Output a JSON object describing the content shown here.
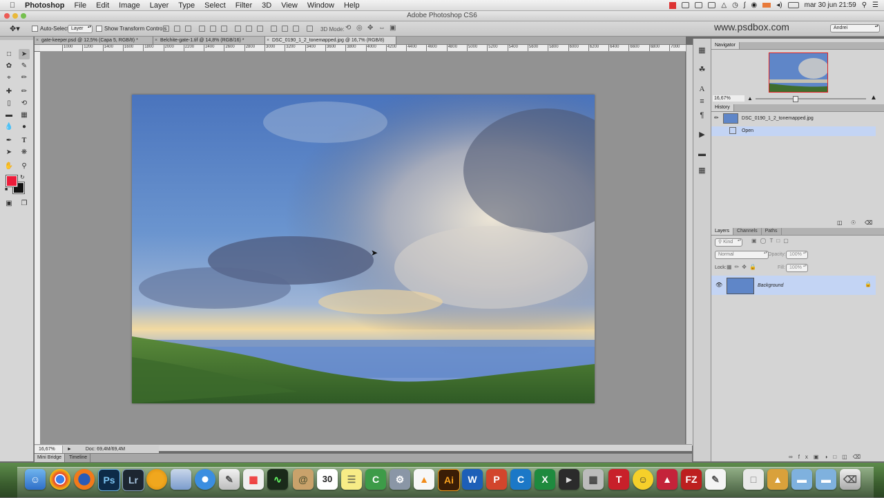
{
  "menubar": {
    "app_name": "Photoshop",
    "items": [
      "File",
      "Edit",
      "Image",
      "Layer",
      "Type",
      "Select",
      "Filter",
      "3D",
      "View",
      "Window",
      "Help"
    ],
    "clock": "mar 30 jun  21:59"
  },
  "window": {
    "title": "Adobe Photoshop CS6"
  },
  "options_bar": {
    "auto_select_label": "Auto-Select:",
    "auto_select_target": "Layer",
    "show_transform_label": "Show Transform Controls",
    "mode_3d_label": "3D Mode:",
    "workspace": "Andrei"
  },
  "watermark_site": "www.psdbox.com",
  "tabs": [
    {
      "label": "gate-keeper.psd @ 12,5% (Capa 5, RGB/8) *"
    },
    {
      "label": "Belchite-gate-1.tif @ 14,8% (RGB/16) *"
    },
    {
      "label": "DSC_0190_1_2_tonemapped.jpg @ 16,7% (RGB/8)"
    }
  ],
  "ruler_ticks": [
    "1000",
    "1200",
    "1400",
    "1600",
    "1800",
    "2000",
    "2200",
    "2400",
    "2600",
    "2800",
    "3000",
    "3200",
    "3400",
    "3600",
    "3800",
    "4000",
    "4200",
    "4400",
    "4600",
    "4800",
    "5000",
    "5200",
    "5400",
    "5600",
    "5800",
    "6000",
    "6200",
    "6400",
    "6600",
    "6800",
    "7000"
  ],
  "status": {
    "zoom": "16,67%",
    "doc_size": "Doc: 69,4M/69,4M"
  },
  "bottom_tabs": [
    "Mini Bridge",
    "Timeline"
  ],
  "navigator": {
    "tab": "Navigator",
    "zoom": "16,67%"
  },
  "history": {
    "tab": "History",
    "snapshot": "DSC_0190_1_2_tonemapped.jpg",
    "states": [
      "Open"
    ]
  },
  "layers_panel": {
    "tabs": [
      "Layers",
      "Channels",
      "Paths"
    ],
    "filter_kind": "Kind",
    "blend_mode": "Normal",
    "opacity_label": "Opacity:",
    "opacity_value": "100%",
    "lock_label": "Lock:",
    "fill_label": "Fill:",
    "fill_value": "100%",
    "layers": [
      {
        "name": "Background"
      }
    ]
  },
  "colors": {
    "foreground": "#ec1c3a",
    "background": "#111111",
    "selection": "#c3d4f4"
  },
  "dock_items": [
    "finder-icon",
    "chrome-icon",
    "firefox-icon",
    "photoshop-icon",
    "lightroom-icon",
    "outlook-icon",
    "preview-icon",
    "safari-icon",
    "script-editor-icon",
    "launchpad-icon",
    "activity-monitor-icon",
    "contacts-icon",
    "calendar-icon",
    "stickies-icon",
    "camtasia-icon",
    "system-prefs-icon",
    "vlc-icon",
    "illustrator-icon",
    "word-icon",
    "powerpoint-icon",
    "cinema4d-icon",
    "excel-icon",
    "final-cut-icon",
    "calculator-icon",
    "typora-icon",
    "cyberduck-icon",
    "mindmeister-icon",
    "filezilla-icon",
    "textedit-icon",
    "document-icon",
    "folder-icon",
    "folder-icon-2",
    "folder-icon-3",
    "trash-icon"
  ],
  "dock_labels": {
    "photoshop": "Ps",
    "lightroom": "Lr",
    "calendar_day": "30",
    "filezilla": "FZ",
    "typora": "T",
    "excel": "X",
    "word": "W",
    "illustrator": "Ai"
  }
}
